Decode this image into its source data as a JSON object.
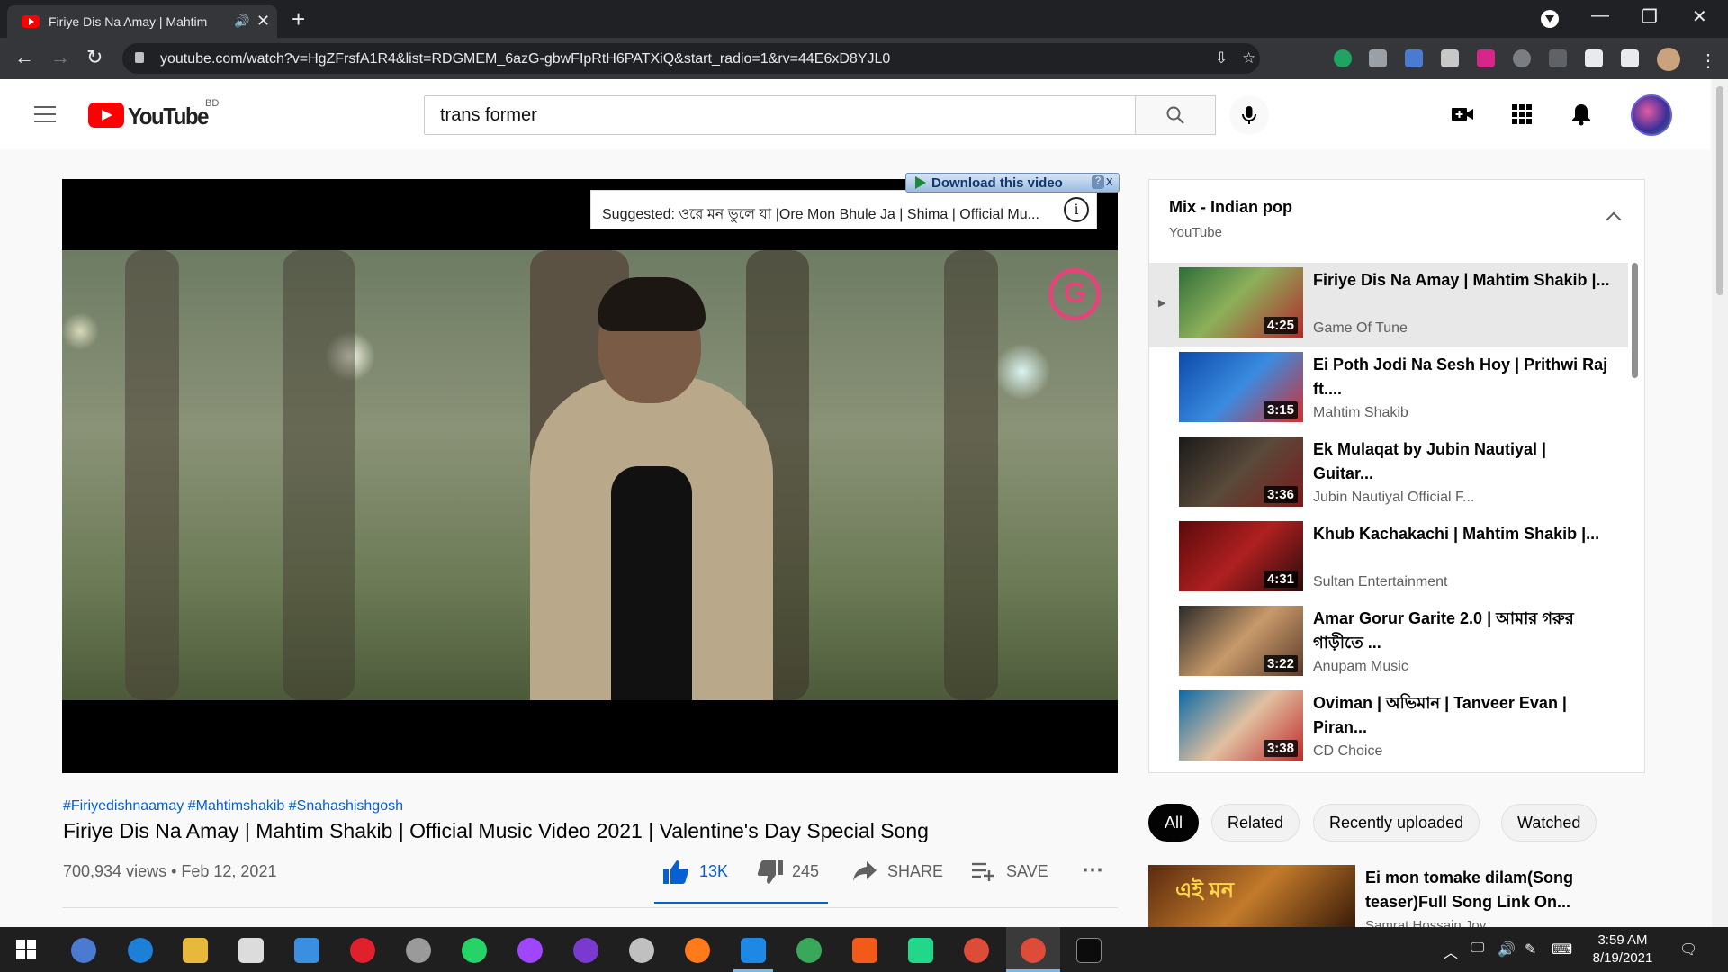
{
  "browser": {
    "tab_title": "Firiye Dis Na Amay | Mahtim",
    "tab_audio": "🔊",
    "tab_close": "✕",
    "new_tab": "+",
    "url": "youtube.com/watch?v=HgZFrsfA1R4&list=RDGMEM_6azG-gbwFIpRtH6PATXiQ&start_radio=1&rv=44E6xD8YJL0",
    "window_controls": {
      "minimize": "—",
      "maximize": "❐",
      "close": "✕"
    }
  },
  "youtube": {
    "country_code": "BD",
    "logo_text": "YouTube",
    "search_query": "trans former"
  },
  "player": {
    "download_label": "Download this video",
    "download_help": "?",
    "download_close": "x",
    "suggested_text": "Suggested: ওরে মন ভুলে যা |Ore Mon Bhule Ja | Shima | Official Mu...",
    "info_glyph": "i"
  },
  "video": {
    "hashtags": "#Firiyedishnaamay #Mahtimshakib #Snahashishgosh",
    "title": "Firiye Dis Na Amay | Mahtim Shakib | Official Music Video 2021 | Valentine's Day Special Song",
    "views_date": "700,934 views • Feb 12, 2021",
    "likes": "13K",
    "dislikes": "245",
    "share_label": "SHARE",
    "save_label": "SAVE"
  },
  "playlist": {
    "title": "Mix - Indian pop",
    "channel": "YouTube",
    "now_playing_glyph": "▶",
    "items": [
      {
        "title": "Firiye Dis Na Amay | Mahtim Shakib |...",
        "channel": "Game Of Tune",
        "duration": "4:25"
      },
      {
        "title": "Ei Poth Jodi Na Sesh Hoy | Prithwi Raj ft....",
        "channel": "Mahtim Shakib",
        "duration": "3:15"
      },
      {
        "title": "Ek Mulaqat by Jubin Nautiyal | Guitar...",
        "channel": "Jubin Nautiyal Official F...",
        "duration": "3:36"
      },
      {
        "title": "Khub Kachakachi | Mahtim Shakib |...",
        "channel": "Sultan Entertainment",
        "duration": "4:31"
      },
      {
        "title": "Amar Gorur Garite 2.0 | আমার গরুর গাড়ীতে ...",
        "channel": "Anupam Music",
        "duration": "3:22"
      },
      {
        "title": "Oviman | অভিমান | Tanveer Evan | Piran...",
        "channel": "CD Choice",
        "duration": "3:38"
      }
    ]
  },
  "chips": [
    "All",
    "Related",
    "Recently uploaded",
    "Watched"
  ],
  "related": {
    "title": "Ei mon tomake dilam(Song teaser)Full Song Link On...",
    "channel": "Samrat Hossain Joy"
  },
  "taskbar": {
    "time": "3:59 AM",
    "date": "8/19/2021"
  },
  "colors": {
    "youtube_red": "#ff0000",
    "link_blue": "#065fd4",
    "chrome_dark": "#202124"
  }
}
